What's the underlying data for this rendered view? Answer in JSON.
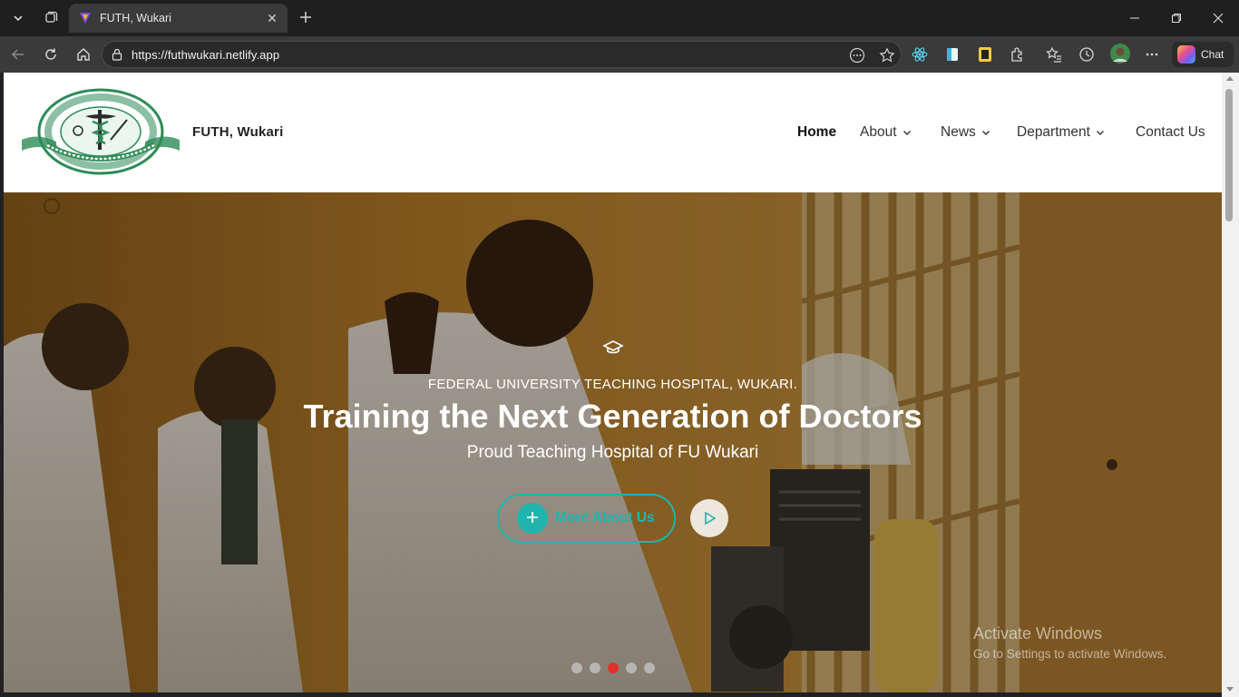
{
  "browser": {
    "tab_title": "FUTH, Wukari",
    "url": "https://futhwukari.netlify.app",
    "chat_label": "Chat"
  },
  "site": {
    "brand": "FUTH, Wukari",
    "nav": [
      {
        "label": "Home",
        "active": true
      },
      {
        "label": "About",
        "dropdown": true
      },
      {
        "label": "News",
        "dropdown": true
      },
      {
        "label": "Department",
        "dropdown": true
      },
      {
        "label": "Contact Us"
      }
    ]
  },
  "hero": {
    "kicker": "FEDERAL UNIVERSITY TEACHING HOSPITAL, WUKARI.",
    "headline": "Training the Next Generation of Doctors",
    "subtitle": "Proud Teaching Hospital of FU Wukari",
    "cta_label": "More About Us",
    "slides_count": 5,
    "active_slide": 3,
    "accent_color": "#1fb5ad",
    "active_dot_color": "#e03131"
  },
  "windows_watermark": {
    "line1": "Activate Windows",
    "line2": "Go to Settings to activate Windows."
  }
}
